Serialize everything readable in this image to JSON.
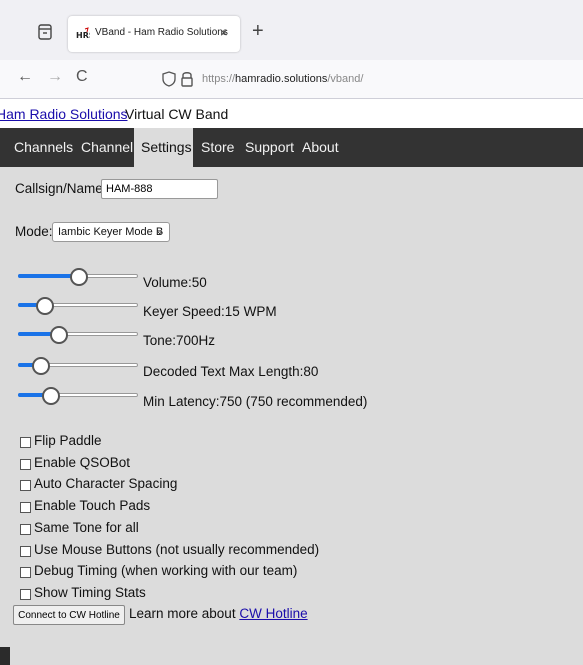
{
  "browser": {
    "tab_title": "VBand - Ham Radio Solutions",
    "tab_close": "×",
    "new_tab": "+",
    "back": "←",
    "forward": "→",
    "reload": "C",
    "url_prefix": "https://",
    "url_host": "hamradio.solutions",
    "url_path": "/vband/"
  },
  "header": {
    "site_link": "Ham Radio Solutions",
    "site_rest": " Virtual CW Band"
  },
  "menu": {
    "items": [
      "Channels",
      "Channel",
      "Settings",
      "Store",
      "Support",
      "About"
    ],
    "active": "Settings"
  },
  "settings": {
    "callsign_label": "Callsign/Name:",
    "callsign_value": "HAM-888",
    "mode_label": "Mode:",
    "mode_value": "Iambic Keyer Mode B",
    "sliders": [
      {
        "label": "Volume:50",
        "level": 0.5
      },
      {
        "label": "Keyer Speed:15 WPM",
        "level": 0.22
      },
      {
        "label": "Tone:700Hz",
        "level": 0.33
      },
      {
        "label": "Decoded Text Max Length:80",
        "level": 0.18
      },
      {
        "label": "Min Latency:750 (750 recommended)",
        "level": 0.27
      }
    ],
    "checkboxes": [
      "Flip Paddle",
      "Enable QSOBot",
      "Auto Character Spacing",
      "Enable Touch Pads",
      "Same Tone for all",
      "Use Mouse Buttons (not usually recommended)",
      "Debug Timing (when working with our team)",
      "Show Timing Stats"
    ]
  },
  "hotline": {
    "button": "Connect to CW Hotline",
    "text": " Learn more about ",
    "link": "CW Hotline"
  },
  "colors": {
    "menu_bg": "#333333",
    "page_bg": "#dcdcdc",
    "slider_fill": "#1a73e8",
    "link": "#1a0dab"
  }
}
